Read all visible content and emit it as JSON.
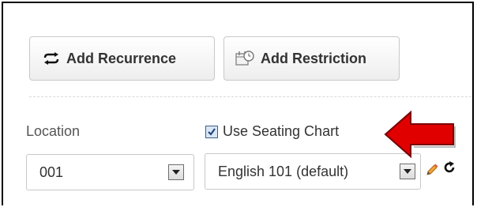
{
  "toolbar": {
    "add_recurrence_label": "Add Recurrence",
    "add_restriction_label": "Add Restriction",
    "add_recurrence_icon": "recurrence-arrows-icon",
    "add_restriction_icon": "restriction-calendar-icon"
  },
  "location": {
    "label": "Location",
    "value": "001"
  },
  "seating_chart": {
    "checkbox_label": "Use Seating Chart",
    "checked": true,
    "selected": "English 101 (default)",
    "edit_icon": "pencil-icon",
    "refresh_icon": "refresh-icon"
  },
  "annotation": {
    "icon": "red-arrow-icon",
    "color": "#e00000"
  }
}
